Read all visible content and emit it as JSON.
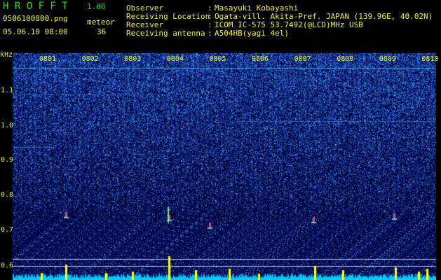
{
  "header": {
    "app_title": "H R O F F T",
    "version": "1.00",
    "filename": "0506100800.png",
    "label_meteor": "meteor",
    "timestamp": "05.06.10 08:00",
    "meteor_count": "36",
    "fields": [
      {
        "label": "Observer",
        "sep": ":",
        "value": "Masayuki Kobayashi"
      },
      {
        "label": "Receiving Location",
        "sep": ":",
        "value": "Ogata-vill. Akita-Pref. JAPAN (139.96E, 40.02N)"
      },
      {
        "label": "Receiver",
        "sep": ":",
        "value": "ICOM IC-575 53.7492(@LCD)MHz USB"
      },
      {
        "label": "Receiving antenna",
        "sep": ":",
        "value": "A504HB(yagi 4el)"
      }
    ]
  },
  "chart_data": {
    "type": "heatmap",
    "ylabel": "kHz",
    "yticks": [
      "1.1",
      "1.0",
      "0.9",
      "0.8",
      "0.7",
      "0.6"
    ],
    "xticks": [
      "0801",
      "0802",
      "0803",
      "0804",
      "0805",
      "0806",
      "0807",
      "0808",
      "0809",
      "0810"
    ],
    "colors": {
      "background": "#04043a",
      "noise": "#2a5cff",
      "echo": "#ff3a6a",
      "bar": "#ffff00",
      "base": "#00c8ff"
    }
  }
}
